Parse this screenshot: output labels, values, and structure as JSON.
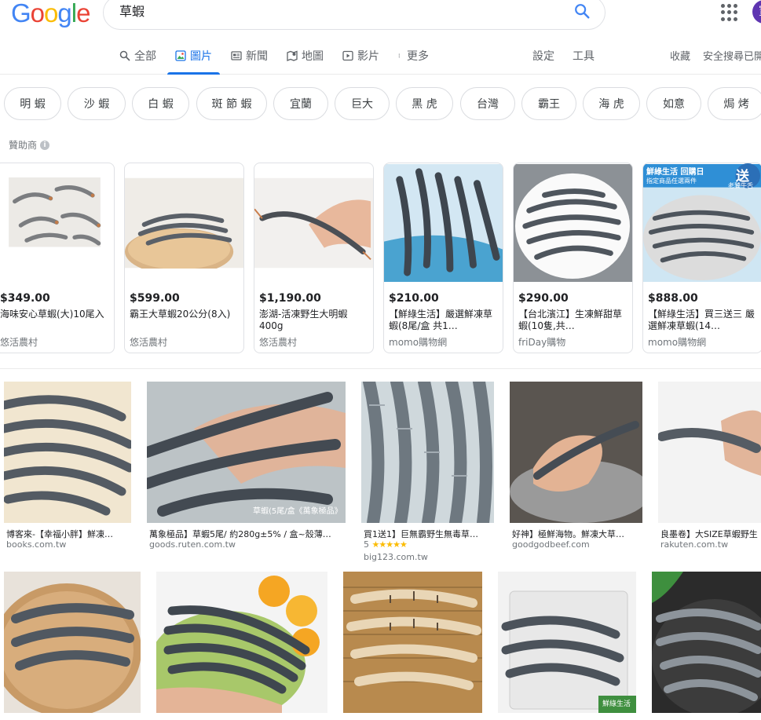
{
  "logo": {
    "letters": [
      "G",
      "o",
      "o",
      "g",
      "l",
      "e"
    ],
    "colors": [
      "#4285f4",
      "#ea4335",
      "#fbbc05",
      "#4285f4",
      "#34a853",
      "#ea4335"
    ]
  },
  "search": {
    "query": "草蝦"
  },
  "avatar": {
    "letter": "寶",
    "color": "#5e35b1"
  },
  "tabs": [
    {
      "label": "全部",
      "icon": "search-icon"
    },
    {
      "label": "圖片",
      "icon": "image-icon",
      "active": true
    },
    {
      "label": "新聞",
      "icon": "news-icon"
    },
    {
      "label": "地圖",
      "icon": "map-icon"
    },
    {
      "label": "影片",
      "icon": "video-icon"
    },
    {
      "label": "更多",
      "icon": "more-icon"
    }
  ],
  "tab_tools": {
    "settings": "設定",
    "tools": "工具",
    "collections": "收藏",
    "safesearch": "安全搜尋已開"
  },
  "chips": [
    "明 蝦",
    "沙 蝦",
    "白 蝦",
    "斑 節 蝦",
    "宜蘭",
    "巨大",
    "黑 虎",
    "台灣",
    "霸王",
    "海 虎",
    "如意",
    "焗 烤"
  ],
  "sponsored_label": "贊助商",
  "products": [
    {
      "price": "$349.00",
      "title": "海味安心草蝦(大)10尾入",
      "merchant": "悠活農村"
    },
    {
      "price": "$599.00",
      "title": "霸王大草蝦20公分(8入)",
      "merchant": "悠活農村"
    },
    {
      "price": "$1,190.00",
      "title": "澎湖-活凍野生大明蝦400g",
      "merchant": "悠活農村"
    },
    {
      "price": "$210.00",
      "title": "【鮮綠生活】嚴選鮮凍草蝦(8尾/盒 共1…",
      "merchant": "momo購物網"
    },
    {
      "price": "$290.00",
      "title": "【台北濱江】生凍鮮甜草蝦(10隻,共…",
      "merchant": "friDay購物"
    },
    {
      "price": "$888.00",
      "title": "【鮮綠生活】買三送三 嚴選鮮凍草蝦(14…",
      "merchant": "momo購物網",
      "badge": "送",
      "badge_sub": "老饕牛舌",
      "banner": "鮮綠生活 回購日",
      "banner_sub": "指定商品任選兩件"
    }
  ],
  "images_row1": [
    {
      "caption": "博客來-【幸福小胖】鮮凍…",
      "domain": "books.com.tw"
    },
    {
      "caption": "萬象極品】草蝦5尾/ 約280g±5% / 盒~殼薄…",
      "domain": "goods.ruten.com.tw",
      "watermark": "草蝦(5尾/盒《萬象極品》"
    },
    {
      "caption": "買1送1】巨無霸野生無毒草…",
      "rating": "5",
      "stars": "★★★★★",
      "domain": "big123.com.tw"
    },
    {
      "caption": "好神】極鮮海物。鮮凍大草…",
      "domain": "goodgodbeef.com"
    },
    {
      "caption": "良墨卷】大SIZE草蝦野生",
      "domain": "rakuten.com.tw"
    }
  ],
  "images_row2_watermark": "鮮綠生活"
}
